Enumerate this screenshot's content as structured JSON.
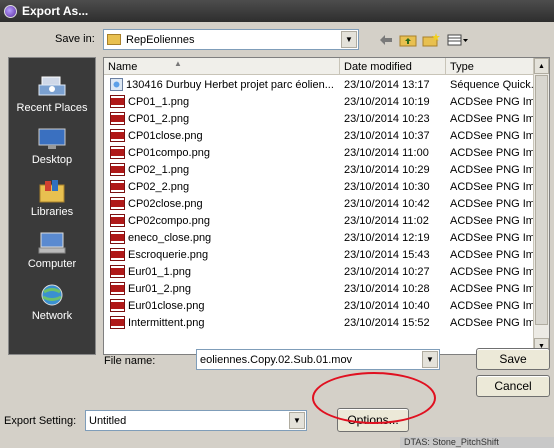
{
  "window": {
    "title": "Export As..."
  },
  "save_in": {
    "label": "Save in:",
    "value": "RepEoliennes"
  },
  "toolbar": {
    "back_icon": "back-arrow-icon",
    "up_icon": "up-folder-icon",
    "new_folder_icon": "new-folder-icon",
    "view_icon": "view-menu-icon"
  },
  "places": [
    {
      "label": "Recent Places",
      "icon": "recent-places-icon"
    },
    {
      "label": "Desktop",
      "icon": "desktop-icon"
    },
    {
      "label": "Libraries",
      "icon": "libraries-icon"
    },
    {
      "label": "Computer",
      "icon": "computer-icon"
    },
    {
      "label": "Network",
      "icon": "network-icon"
    }
  ],
  "columns": {
    "name": "Name",
    "date": "Date modified",
    "type": "Type"
  },
  "files": [
    {
      "name": "130416 Durbuy Herbet projet parc éolien...",
      "date": "23/10/2014 13:17",
      "type": "Séquence Quick...",
      "icon": "mov"
    },
    {
      "name": "CP01_1.png",
      "date": "23/10/2014 10:19",
      "type": "ACDSee PNG Im...",
      "icon": "png"
    },
    {
      "name": "CP01_2.png",
      "date": "23/10/2014 10:23",
      "type": "ACDSee PNG Im...",
      "icon": "png"
    },
    {
      "name": "CP01close.png",
      "date": "23/10/2014 10:37",
      "type": "ACDSee PNG Im...",
      "icon": "png"
    },
    {
      "name": "CP01compo.png",
      "date": "23/10/2014 11:00",
      "type": "ACDSee PNG Im...",
      "icon": "png"
    },
    {
      "name": "CP02_1.png",
      "date": "23/10/2014 10:29",
      "type": "ACDSee PNG Im...",
      "icon": "png"
    },
    {
      "name": "CP02_2.png",
      "date": "23/10/2014 10:30",
      "type": "ACDSee PNG Im...",
      "icon": "png"
    },
    {
      "name": "CP02close.png",
      "date": "23/10/2014 10:42",
      "type": "ACDSee PNG Im...",
      "icon": "png"
    },
    {
      "name": "CP02compo.png",
      "date": "23/10/2014 11:02",
      "type": "ACDSee PNG Im...",
      "icon": "png"
    },
    {
      "name": "eneco_close.png",
      "date": "23/10/2014 12:19",
      "type": "ACDSee PNG Im...",
      "icon": "png"
    },
    {
      "name": "Escroquerie.png",
      "date": "23/10/2014 15:43",
      "type": "ACDSee PNG Im...",
      "icon": "png"
    },
    {
      "name": "Eur01_1.png",
      "date": "23/10/2014 10:27",
      "type": "ACDSee PNG Im...",
      "icon": "png"
    },
    {
      "name": "Eur01_2.png",
      "date": "23/10/2014 10:28",
      "type": "ACDSee PNG Im...",
      "icon": "png"
    },
    {
      "name": "Eur01close.png",
      "date": "23/10/2014 10:40",
      "type": "ACDSee PNG Im...",
      "icon": "png"
    },
    {
      "name": "Intermittent.png",
      "date": "23/10/2014 15:52",
      "type": "ACDSee PNG Im...",
      "icon": "png"
    }
  ],
  "file_name": {
    "label": "File name:",
    "value": "eoliennes.Copy.02.Sub.01.mov"
  },
  "buttons": {
    "save": "Save",
    "cancel": "Cancel",
    "options": "Options..."
  },
  "export_setting": {
    "label": "Export Setting:",
    "value": "Untitled"
  },
  "status_strip": "DTAS: Stone_PitchShift",
  "colors": {
    "annotation_circle": "#e01020",
    "titlebar": "#3a3a3a",
    "dialog": "#d4d0c8"
  }
}
